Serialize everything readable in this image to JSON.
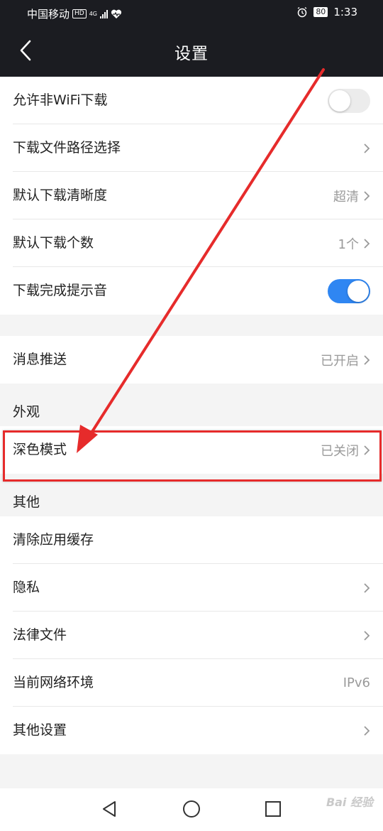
{
  "status_bar": {
    "carrier": "中国移动",
    "hd": "HD",
    "network": "4G",
    "battery": "80",
    "time": "1:33"
  },
  "header": {
    "title": "设置"
  },
  "groups": {
    "download": [
      {
        "label": "允许非WiFi下载",
        "toggle": "off"
      },
      {
        "label": "下载文件路径选择",
        "chevron": true
      },
      {
        "label": "默认下载清晰度",
        "value": "超清",
        "chevron": true
      },
      {
        "label": "默认下载个数",
        "value": "1个",
        "chevron": true
      },
      {
        "label": "下载完成提示音",
        "toggle": "on"
      }
    ],
    "push": [
      {
        "label": "消息推送",
        "value": "已开启",
        "chevron": true
      }
    ],
    "appearance": {
      "header": "外观",
      "items": [
        {
          "label": "深色模式",
          "value": "已关闭",
          "chevron": true
        }
      ]
    },
    "other": {
      "header": "其他",
      "items": [
        {
          "label": "清除应用缓存"
        },
        {
          "label": "隐私",
          "chevron": true
        },
        {
          "label": "法律文件",
          "chevron": true
        },
        {
          "label": "当前网络环境",
          "value": "IPv6"
        },
        {
          "label": "其他设置",
          "chevron": true
        }
      ]
    }
  },
  "watermark": "Bai 经验",
  "colors": {
    "bar_bg": "#1b1c21",
    "toggle_on": "#2f86f2",
    "annotation_red": "#e62b2b"
  }
}
